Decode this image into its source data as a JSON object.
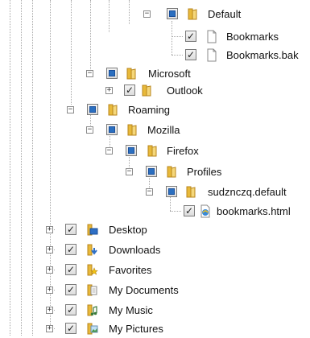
{
  "tree": {
    "default_folder": "Default",
    "bookmarks_file": "Bookmarks",
    "bookmarks_bak_file": "Bookmarks.bak",
    "microsoft_folder": "Microsoft",
    "outlook_folder": "Outlook",
    "roaming_folder": "Roaming",
    "mozilla_folder": "Mozilla",
    "firefox_folder": "Firefox",
    "profiles_folder": "Profiles",
    "profile_folder": "sudznczq.default",
    "bookmarks_html_file": "bookmarks.html",
    "desktop_folder": "Desktop",
    "downloads_folder": "Downloads",
    "favorites_folder": "Favorites",
    "my_documents_folder": "My Documents",
    "my_music_folder": "My Music",
    "my_pictures_folder": "My Pictures"
  },
  "glyphs": {
    "expanded": "−",
    "collapsed": "+",
    "checked": "✓"
  },
  "colors": {
    "folder": "#e8b93a",
    "partial_check": "#2b6fc0",
    "tree_line": "#a8a8a8"
  }
}
